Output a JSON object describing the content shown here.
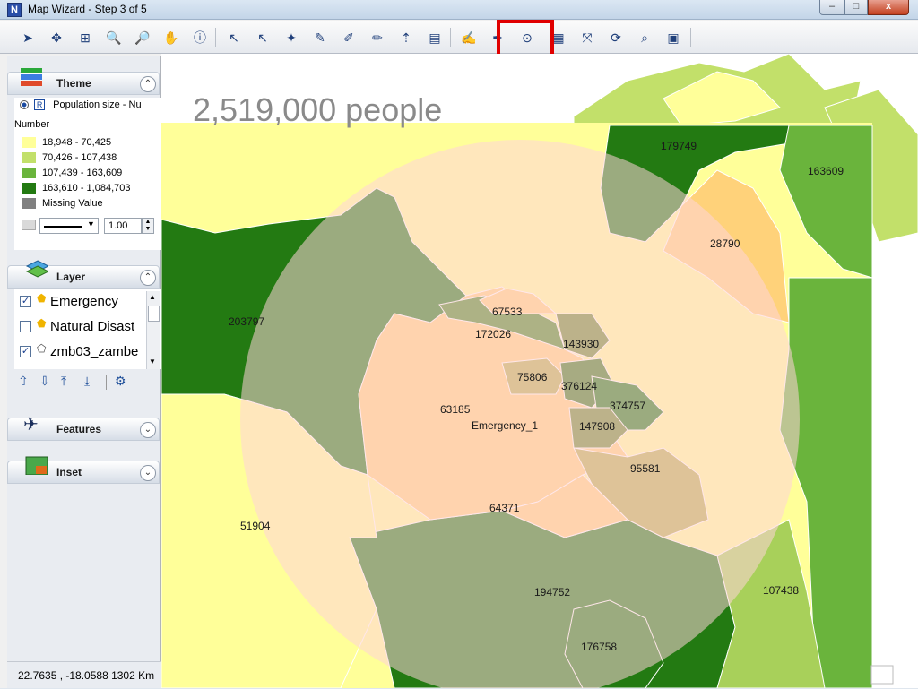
{
  "window": {
    "title": "Map Wizard - Step 3 of 5",
    "buttons": {
      "minimize": "–",
      "maximize": "□",
      "close": "x"
    }
  },
  "toolbar": {
    "tools": [
      "select-arrow-icon",
      "pan-center-icon",
      "zoom-extent-icon",
      "zoom-in-icon",
      "zoom-out-icon",
      "hand-pan-icon",
      "info-icon",
      "select-plus-icon",
      "select-minus-icon",
      "select-point-icon",
      "edit-pencil-icon",
      "edit-vertex-icon",
      "edit-line-icon",
      "north-arrow-icon",
      "legend-box-icon",
      "label-tool-icon",
      "label-edit-icon",
      "buffer-circle-icon",
      "print-icon",
      "route-icon",
      "refresh-icon",
      "search-icon",
      "layout-icon"
    ],
    "highlighted": "buffer-circle-icon",
    "highlight_color": "#e00000"
  },
  "theme": {
    "header": "Theme",
    "field": "Population size - Nu",
    "legend_title": "Number",
    "classes": [
      {
        "label": "18,948 - 70,425",
        "color": "#ffff99"
      },
      {
        "label": "70,426 - 107,438",
        "color": "#c2e06a"
      },
      {
        "label": "107,439 - 163,609",
        "color": "#6ab43c"
      },
      {
        "label": "163,610 - 1,084,703",
        "color": "#237a12"
      },
      {
        "label": "Missing Value",
        "color": "#808080"
      }
    ],
    "line_width": "1.00"
  },
  "layer": {
    "header": "Layer",
    "items": [
      {
        "name": "Emergency",
        "checked": true
      },
      {
        "name": "Natural Disast",
        "checked": false
      },
      {
        "name": "zmb03_zambe",
        "checked": true
      }
    ]
  },
  "features": {
    "header": "Features"
  },
  "inset": {
    "header": "Inset"
  },
  "status": {
    "coords": "22.7635 , -18.0588   1302 Km"
  },
  "map": {
    "buffer_total": "2,519,000 people",
    "center_label": "Emergency_1",
    "buffer_color": "#ffd3d8",
    "regions": [
      {
        "label": "179749"
      },
      {
        "label": "163609"
      },
      {
        "label": "28790"
      },
      {
        "label": "203797"
      },
      {
        "label": "67533"
      },
      {
        "label": "172026"
      },
      {
        "label": "143930"
      },
      {
        "label": "75806"
      },
      {
        "label": "376124"
      },
      {
        "label": "374757"
      },
      {
        "label": "63185"
      },
      {
        "label": "147908"
      },
      {
        "label": "95581"
      },
      {
        "label": "64371"
      },
      {
        "label": "51904"
      },
      {
        "label": "194752"
      },
      {
        "label": "107438"
      },
      {
        "label": "176758"
      }
    ]
  }
}
